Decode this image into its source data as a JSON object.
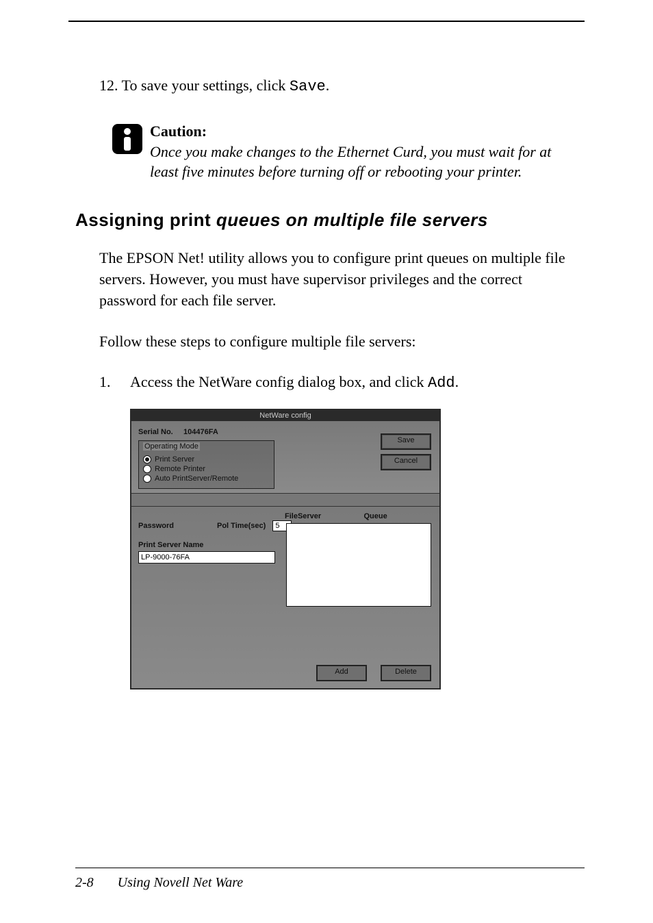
{
  "step12": {
    "number": "12.",
    "text_before": "To save your settings, click ",
    "code": "Save",
    "text_after": "."
  },
  "caution": {
    "heading": "Caution:",
    "body": "Once you make changes to the Ethernet Curd, you must wait for at least five minutes before turning off or rebooting your printer."
  },
  "section_heading": {
    "part1": "Assigning print ",
    "part2_italic": "queues on multiple file servers"
  },
  "para1": "The EPSON Net! utility allows you to configure print queues on multiple file servers. However, you must have supervisor privileges and the correct password for each file server.",
  "para2": "Follow these steps to configure multiple file servers:",
  "step1": {
    "number": "1.",
    "text_before": "Access the NetWare config dialog box, and click ",
    "code": "Add",
    "text_after": "."
  },
  "dialog": {
    "title": "NetWare config",
    "serial_label": "Serial No.",
    "serial_value": "104476FA",
    "operating_mode_legend": "Operating Mode",
    "radios": {
      "print_server": "Print Server",
      "remote_printer": "Remote Printer",
      "auto": "Auto PrintServer/Remote"
    },
    "selected_radio": "print_server",
    "save_btn": "Save",
    "cancel_btn": "Cancel",
    "pol_time_label": "Pol Time(sec)",
    "pol_time_value": "5",
    "password_label": "Password",
    "fileserver_col": "FileServer",
    "queue_col": "Queue",
    "print_server_name_label": "Print Server Name",
    "print_server_name_value": "LP-9000-76FA",
    "add_btn": "Add",
    "delete_btn": "Delete"
  },
  "footer": {
    "page_num": "2-8",
    "running_head": "Using Novell Net Ware"
  }
}
